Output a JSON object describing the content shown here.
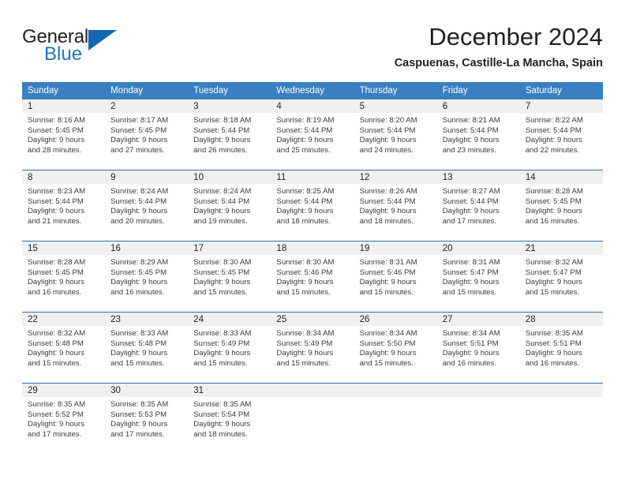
{
  "brand": {
    "name_top": "General",
    "name_bottom": "Blue",
    "accent_color": "#1667b1",
    "flag_icon": "triangle-flag-icon"
  },
  "header": {
    "month_title": "December 2024",
    "location": "Caspuenas, Castille-La Mancha, Spain"
  },
  "theme": {
    "header_bg": "#3a7fc1",
    "row_separator": "#2f6fb0",
    "daynum_bg": "#f0f0f0",
    "text": "#231f20"
  },
  "calendar": {
    "weekday_headers": [
      "Sunday",
      "Monday",
      "Tuesday",
      "Wednesday",
      "Thursday",
      "Friday",
      "Saturday"
    ],
    "weeks": [
      [
        {
          "day": "1",
          "sunrise": "Sunrise: 8:16 AM",
          "sunset": "Sunset: 5:45 PM",
          "daylight1": "Daylight: 9 hours",
          "daylight2": "and 28 minutes."
        },
        {
          "day": "2",
          "sunrise": "Sunrise: 8:17 AM",
          "sunset": "Sunset: 5:45 PM",
          "daylight1": "Daylight: 9 hours",
          "daylight2": "and 27 minutes."
        },
        {
          "day": "3",
          "sunrise": "Sunrise: 8:18 AM",
          "sunset": "Sunset: 5:44 PM",
          "daylight1": "Daylight: 9 hours",
          "daylight2": "and 26 minutes."
        },
        {
          "day": "4",
          "sunrise": "Sunrise: 8:19 AM",
          "sunset": "Sunset: 5:44 PM",
          "daylight1": "Daylight: 9 hours",
          "daylight2": "and 25 minutes."
        },
        {
          "day": "5",
          "sunrise": "Sunrise: 8:20 AM",
          "sunset": "Sunset: 5:44 PM",
          "daylight1": "Daylight: 9 hours",
          "daylight2": "and 24 minutes."
        },
        {
          "day": "6",
          "sunrise": "Sunrise: 8:21 AM",
          "sunset": "Sunset: 5:44 PM",
          "daylight1": "Daylight: 9 hours",
          "daylight2": "and 23 minutes."
        },
        {
          "day": "7",
          "sunrise": "Sunrise: 8:22 AM",
          "sunset": "Sunset: 5:44 PM",
          "daylight1": "Daylight: 9 hours",
          "daylight2": "and 22 minutes."
        }
      ],
      [
        {
          "day": "8",
          "sunrise": "Sunrise: 8:23 AM",
          "sunset": "Sunset: 5:44 PM",
          "daylight1": "Daylight: 9 hours",
          "daylight2": "and 21 minutes."
        },
        {
          "day": "9",
          "sunrise": "Sunrise: 8:24 AM",
          "sunset": "Sunset: 5:44 PM",
          "daylight1": "Daylight: 9 hours",
          "daylight2": "and 20 minutes."
        },
        {
          "day": "10",
          "sunrise": "Sunrise: 8:24 AM",
          "sunset": "Sunset: 5:44 PM",
          "daylight1": "Daylight: 9 hours",
          "daylight2": "and 19 minutes."
        },
        {
          "day": "11",
          "sunrise": "Sunrise: 8:25 AM",
          "sunset": "Sunset: 5:44 PM",
          "daylight1": "Daylight: 9 hours",
          "daylight2": "and 18 minutes."
        },
        {
          "day": "12",
          "sunrise": "Sunrise: 8:26 AM",
          "sunset": "Sunset: 5:44 PM",
          "daylight1": "Daylight: 9 hours",
          "daylight2": "and 18 minutes."
        },
        {
          "day": "13",
          "sunrise": "Sunrise: 8:27 AM",
          "sunset": "Sunset: 5:44 PM",
          "daylight1": "Daylight: 9 hours",
          "daylight2": "and 17 minutes."
        },
        {
          "day": "14",
          "sunrise": "Sunrise: 8:28 AM",
          "sunset": "Sunset: 5:45 PM",
          "daylight1": "Daylight: 9 hours",
          "daylight2": "and 16 minutes."
        }
      ],
      [
        {
          "day": "15",
          "sunrise": "Sunrise: 8:28 AM",
          "sunset": "Sunset: 5:45 PM",
          "daylight1": "Daylight: 9 hours",
          "daylight2": "and 16 minutes."
        },
        {
          "day": "16",
          "sunrise": "Sunrise: 8:29 AM",
          "sunset": "Sunset: 5:45 PM",
          "daylight1": "Daylight: 9 hours",
          "daylight2": "and 16 minutes."
        },
        {
          "day": "17",
          "sunrise": "Sunrise: 8:30 AM",
          "sunset": "Sunset: 5:45 PM",
          "daylight1": "Daylight: 9 hours",
          "daylight2": "and 15 minutes."
        },
        {
          "day": "18",
          "sunrise": "Sunrise: 8:30 AM",
          "sunset": "Sunset: 5:46 PM",
          "daylight1": "Daylight: 9 hours",
          "daylight2": "and 15 minutes."
        },
        {
          "day": "19",
          "sunrise": "Sunrise: 8:31 AM",
          "sunset": "Sunset: 5:46 PM",
          "daylight1": "Daylight: 9 hours",
          "daylight2": "and 15 minutes."
        },
        {
          "day": "20",
          "sunrise": "Sunrise: 8:31 AM",
          "sunset": "Sunset: 5:47 PM",
          "daylight1": "Daylight: 9 hours",
          "daylight2": "and 15 minutes."
        },
        {
          "day": "21",
          "sunrise": "Sunrise: 8:32 AM",
          "sunset": "Sunset: 5:47 PM",
          "daylight1": "Daylight: 9 hours",
          "daylight2": "and 15 minutes."
        }
      ],
      [
        {
          "day": "22",
          "sunrise": "Sunrise: 8:32 AM",
          "sunset": "Sunset: 5:48 PM",
          "daylight1": "Daylight: 9 hours",
          "daylight2": "and 15 minutes."
        },
        {
          "day": "23",
          "sunrise": "Sunrise: 8:33 AM",
          "sunset": "Sunset: 5:48 PM",
          "daylight1": "Daylight: 9 hours",
          "daylight2": "and 15 minutes."
        },
        {
          "day": "24",
          "sunrise": "Sunrise: 8:33 AM",
          "sunset": "Sunset: 5:49 PM",
          "daylight1": "Daylight: 9 hours",
          "daylight2": "and 15 minutes."
        },
        {
          "day": "25",
          "sunrise": "Sunrise: 8:34 AM",
          "sunset": "Sunset: 5:49 PM",
          "daylight1": "Daylight: 9 hours",
          "daylight2": "and 15 minutes."
        },
        {
          "day": "26",
          "sunrise": "Sunrise: 8:34 AM",
          "sunset": "Sunset: 5:50 PM",
          "daylight1": "Daylight: 9 hours",
          "daylight2": "and 15 minutes."
        },
        {
          "day": "27",
          "sunrise": "Sunrise: 8:34 AM",
          "sunset": "Sunset: 5:51 PM",
          "daylight1": "Daylight: 9 hours",
          "daylight2": "and 16 minutes."
        },
        {
          "day": "28",
          "sunrise": "Sunrise: 8:35 AM",
          "sunset": "Sunset: 5:51 PM",
          "daylight1": "Daylight: 9 hours",
          "daylight2": "and 16 minutes."
        }
      ],
      [
        {
          "day": "29",
          "sunrise": "Sunrise: 8:35 AM",
          "sunset": "Sunset: 5:52 PM",
          "daylight1": "Daylight: 9 hours",
          "daylight2": "and 17 minutes."
        },
        {
          "day": "30",
          "sunrise": "Sunrise: 8:35 AM",
          "sunset": "Sunset: 5:53 PM",
          "daylight1": "Daylight: 9 hours",
          "daylight2": "and 17 minutes."
        },
        {
          "day": "31",
          "sunrise": "Sunrise: 8:35 AM",
          "sunset": "Sunset: 5:54 PM",
          "daylight1": "Daylight: 9 hours",
          "daylight2": "and 18 minutes."
        },
        {
          "day": "",
          "sunrise": "",
          "sunset": "",
          "daylight1": "",
          "daylight2": ""
        },
        {
          "day": "",
          "sunrise": "",
          "sunset": "",
          "daylight1": "",
          "daylight2": ""
        },
        {
          "day": "",
          "sunrise": "",
          "sunset": "",
          "daylight1": "",
          "daylight2": ""
        },
        {
          "day": "",
          "sunrise": "",
          "sunset": "",
          "daylight1": "",
          "daylight2": ""
        }
      ]
    ]
  }
}
